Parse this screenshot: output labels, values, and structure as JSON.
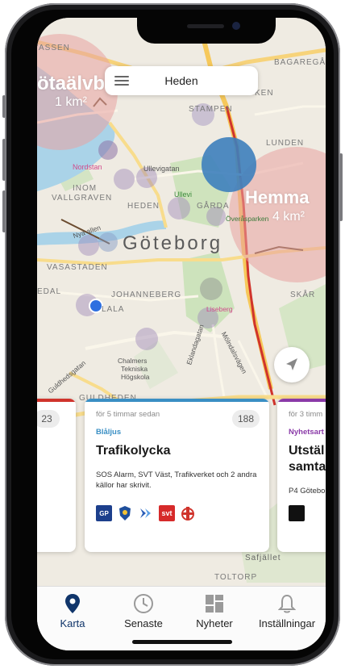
{
  "colors": {
    "accent": "#10356a",
    "bluelight_category": "#3a8fc4",
    "news_category": "#8a3aa8",
    "heat_circle": "#e7a3a0",
    "event_circle": "#3d7fbd",
    "user_location": "#2d6fe0"
  },
  "search": {
    "label": "Heden",
    "icon": "menu-icon"
  },
  "map": {
    "city": "Göteborg",
    "overlays": {
      "left_name": "ötaälvb",
      "left_area": "1 km²",
      "right_name": "Hemma",
      "right_area": "4 km²"
    },
    "places": [
      "Nordstan",
      "INOM",
      "VALLGRAVEN",
      "Ullevigatan",
      "Ullevi",
      "HEDEN",
      "GÅRDA",
      "Överåsparken",
      "Nya allen",
      "VASASTADEN",
      "JOHANNEBERG",
      "Liseberg",
      "SKÅR",
      "Chalmers",
      "Tekniska",
      "Högskola",
      "Eklandagatan",
      "Mölndalsvägen",
      "Guldhedsgatan",
      "LUNDEN",
      "STAMPEN",
      "BAGAREGÅR",
      "ASSEN",
      "EDAL",
      "LALA",
      "GULDHEDEN",
      "Safjället",
      "TOLTORP",
      "KEN"
    ]
  },
  "cards": [
    {
      "count": "23"
    },
    {
      "time": "för 5 timmar sedan",
      "count": "188",
      "category": "Blåljus",
      "title": "Trafikolycka",
      "sources": "SOS Alarm, SVT Väst, Trafikverket och 2 andra källor har skrivit.",
      "logos": [
        "GP",
        "police-icon",
        "traffic-icon",
        "svt",
        "rescue-icon"
      ]
    },
    {
      "time": "för 3 timm",
      "category": "Nyhetsart",
      "title_line1": "Utstäl",
      "title_line2": "samta",
      "sources": "P4 Götebo"
    }
  ],
  "tabs": [
    {
      "label": "Karta",
      "icon": "map-pin-icon",
      "active": true
    },
    {
      "label": "Senaste",
      "icon": "clock-icon",
      "active": false
    },
    {
      "label": "Nyheter",
      "icon": "grid-icon",
      "active": false
    },
    {
      "label": "Inställningar",
      "icon": "bell-icon",
      "active": false
    }
  ]
}
